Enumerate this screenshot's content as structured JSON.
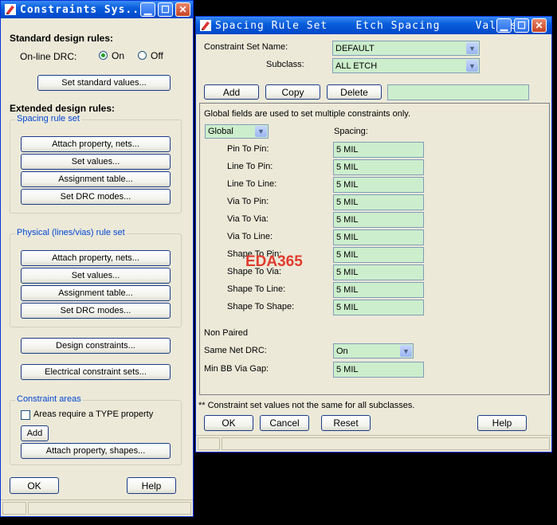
{
  "constraints_window": {
    "title": "Constraints Sys...",
    "standard_rules_heading": "Standard design rules:",
    "online_drc_label": "On-line DRC:",
    "drc_on_label": "On",
    "drc_off_label": "Off",
    "drc_selected": "On",
    "set_standard_values_label": "Set standard values...",
    "extended_rules_heading": "Extended design rules:",
    "spacing_group_label": "Spacing rule set",
    "spacing_buttons": [
      "Attach property, nets...",
      "Set values...",
      "Assignment table...",
      "Set DRC modes..."
    ],
    "physical_group_label": "Physical (lines/vias) rule set",
    "physical_buttons": [
      "Attach property, nets...",
      "Set values...",
      "Assignment table...",
      "Set DRC modes..."
    ],
    "design_constraints_label": "Design constraints...",
    "electrical_constraint_sets_label": "Electrical constraint sets...",
    "constraint_areas_label": "Constraint areas",
    "areas_type_label": "Areas require a TYPE property",
    "add_label": "Add",
    "attach_shapes_label": "Attach property, shapes...",
    "ok_label": "OK",
    "help_label": "Help"
  },
  "spacing_window": {
    "title": "Spacing Rule Set    Etch Spacing     Values",
    "constraint_set_name_label": "Constraint Set Name:",
    "constraint_set_name_value": "DEFAULT",
    "subclass_label": "Subclass:",
    "subclass_value": "ALL ETCH",
    "add_label": "Add",
    "copy_label": "Copy",
    "delete_label": "Delete",
    "new_name_value": "",
    "global_note": "Global fields are used to set multiple constraints only.",
    "scope_value": "Global",
    "spacing_header": "Spacing:",
    "rows": [
      {
        "label": "Pin To Pin:",
        "value": "5 MIL"
      },
      {
        "label": "Line To Pin:",
        "value": "5 MIL"
      },
      {
        "label": "Line To Line:",
        "value": "5 MIL"
      },
      {
        "label": "Via To Pin:",
        "value": "5 MIL"
      },
      {
        "label": "Via To Via:",
        "value": "5 MIL"
      },
      {
        "label": "Via To Line:",
        "value": "5 MIL"
      },
      {
        "label": "Shape To Pin:",
        "value": "5 MIL"
      },
      {
        "label": "Shape To Via:",
        "value": "5 MIL"
      },
      {
        "label": "Shape To Line:",
        "value": "5 MIL"
      },
      {
        "label": "Shape To Shape:",
        "value": "5 MIL"
      }
    ],
    "non_paired_label": "Non Paired",
    "same_net_drc_label": "Same Net DRC:",
    "same_net_drc_value": "On",
    "min_bb_via_gap_label": "Min BB Via Gap:",
    "min_bb_via_gap_value": "5 MIL",
    "footnote": "** Constraint set values not the same for all subclasses.",
    "ok_label": "OK",
    "cancel_label": "Cancel",
    "reset_label": "Reset",
    "help_label": "Help"
  },
  "watermark_text": "EDA365",
  "icons": {
    "app": "app-pencil-icon",
    "minimize": "minimize-icon",
    "maximize": "maximize-icon",
    "close": "close-icon",
    "dropdown": "chevron-down-icon"
  },
  "colors": {
    "titlebar": "#0a5fdc",
    "field_bg": "#cdeecc",
    "group_label": "#0046d5",
    "watermark": "#e03b2f"
  }
}
